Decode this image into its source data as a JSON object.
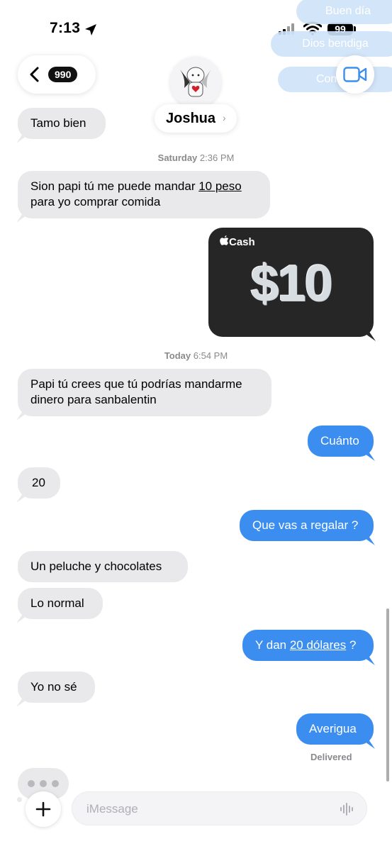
{
  "status_bar": {
    "time": "7:13",
    "battery": "99"
  },
  "top_faded_bubbles": [
    "Buen día",
    "Dios bendiga",
    "Como es"
  ],
  "header": {
    "back_count": "990",
    "contact_name": "Joshua",
    "name_chevron": "›"
  },
  "messages": {
    "m0": "Tamo bien",
    "ts1": {
      "day": "Saturday",
      "time": "2:36 PM"
    },
    "m1_a": "Sion papi tú me puede mandar ",
    "m1_link": "10 peso",
    "m1_b": "para yo comprar comida",
    "cash": {
      "brand": "Cash",
      "amount": "$10"
    },
    "ts2": {
      "day": "Today",
      "time": "6:54 PM"
    },
    "m2_a": "Papi tú crees que tú podrías mandarme",
    "m2_b": "dinero para sanbalentin",
    "m3": "Cuánto",
    "m4": "20",
    "m5": "Que vas a regalar ?",
    "m6": "Un peluche y chocolates",
    "m7": "Lo normal",
    "m8_a": "Y dan ",
    "m8_link": "20 dólares",
    "m8_b": " ?",
    "m9": "Yo no sé",
    "m10": "Averigua",
    "delivered": "Delivered"
  },
  "input": {
    "placeholder": "iMessage"
  },
  "colors": {
    "outgoing": "#3b8ef0",
    "incoming": "#e9e9eb",
    "cash_card": "#262626"
  }
}
